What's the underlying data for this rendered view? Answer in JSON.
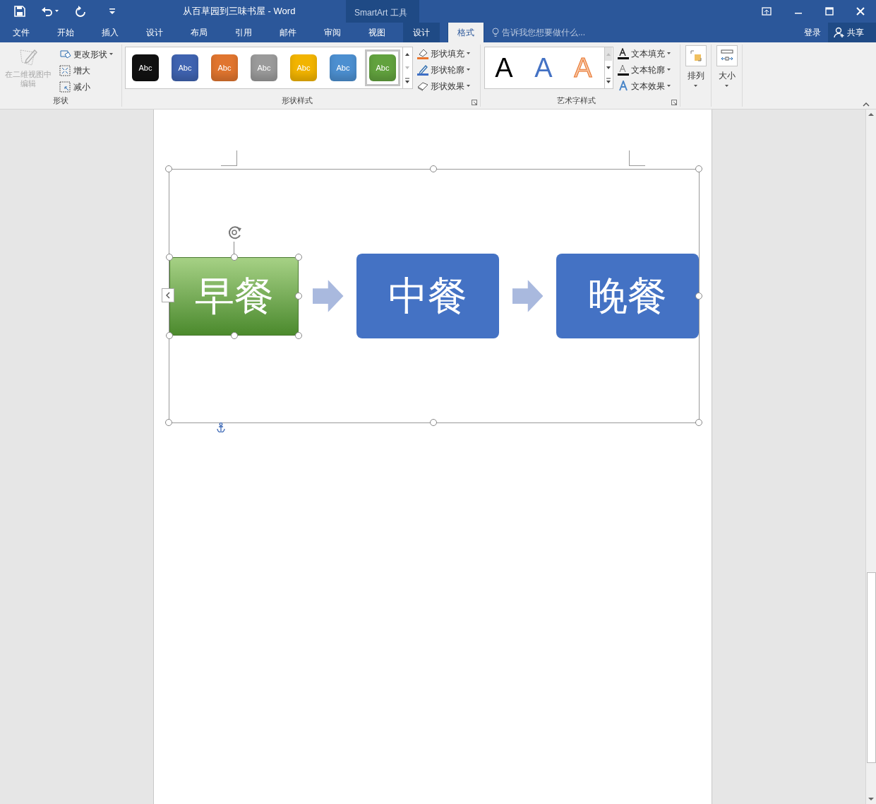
{
  "window": {
    "title": "从百草园到三味书屋 - Word",
    "context_label": "SmartArt 工具"
  },
  "tabs": [
    {
      "label": "文件",
      "selected": false,
      "kind": "normal"
    },
    {
      "label": "开始",
      "selected": false,
      "kind": "normal"
    },
    {
      "label": "插入",
      "selected": false,
      "kind": "normal"
    },
    {
      "label": "设计",
      "selected": false,
      "kind": "normal"
    },
    {
      "label": "布局",
      "selected": false,
      "kind": "normal"
    },
    {
      "label": "引用",
      "selected": false,
      "kind": "normal"
    },
    {
      "label": "邮件",
      "selected": false,
      "kind": "normal"
    },
    {
      "label": "审阅",
      "selected": false,
      "kind": "normal"
    },
    {
      "label": "视图",
      "selected": false,
      "kind": "normal"
    },
    {
      "label": "设计",
      "selected": false,
      "kind": "context"
    },
    {
      "label": "格式",
      "selected": true,
      "kind": "context"
    }
  ],
  "tell_me": {
    "placeholder": "告诉我您想要做什么..."
  },
  "account": {
    "sign_in": "登录",
    "share": "共享"
  },
  "ribbon": {
    "shapes_group": {
      "label": "形状",
      "edit_2d": {
        "label": "在二维视图中编辑",
        "disabled": true
      },
      "commands": [
        {
          "label": "更改形状",
          "dropdown": true
        },
        {
          "label": "增大",
          "dropdown": false
        },
        {
          "label": "减小",
          "dropdown": false
        }
      ]
    },
    "shape_styles_group": {
      "label": "形状样式",
      "gallery": [
        {
          "label": "Abc",
          "color": "#111111",
          "selected": false
        },
        {
          "label": "Abc",
          "color": "#3f63b0",
          "selected": false
        },
        {
          "label": "Abc",
          "color": "#e0752f",
          "selected": false
        },
        {
          "label": "Abc",
          "color": "#9a9a9a",
          "selected": false
        },
        {
          "label": "Abc",
          "color": "#f2b400",
          "selected": false
        },
        {
          "label": "Abc",
          "color": "#4c8fd0",
          "selected": false
        },
        {
          "label": "Abc",
          "color": "#62a23e",
          "selected": true
        }
      ],
      "commands": [
        {
          "label": "形状填充"
        },
        {
          "label": "形状轮廓"
        },
        {
          "label": "形状效果"
        }
      ]
    },
    "wordart_group": {
      "label": "艺术字样式",
      "samples": [
        {
          "label": "A",
          "color": "#000000"
        },
        {
          "label": "A",
          "color": "#4472c4"
        },
        {
          "label": "A",
          "color": "#f7c3a0"
        }
      ],
      "commands": [
        {
          "label": "文本填充"
        },
        {
          "label": "文本轮廓"
        },
        {
          "label": "文本效果"
        }
      ]
    },
    "arrange": {
      "label": "排列"
    },
    "size": {
      "label": "大小"
    }
  },
  "diagram": {
    "nodes": [
      {
        "text": "早餐",
        "selected": true
      },
      {
        "text": "中餐",
        "selected": false
      },
      {
        "text": "晚餐",
        "selected": false
      }
    ]
  }
}
